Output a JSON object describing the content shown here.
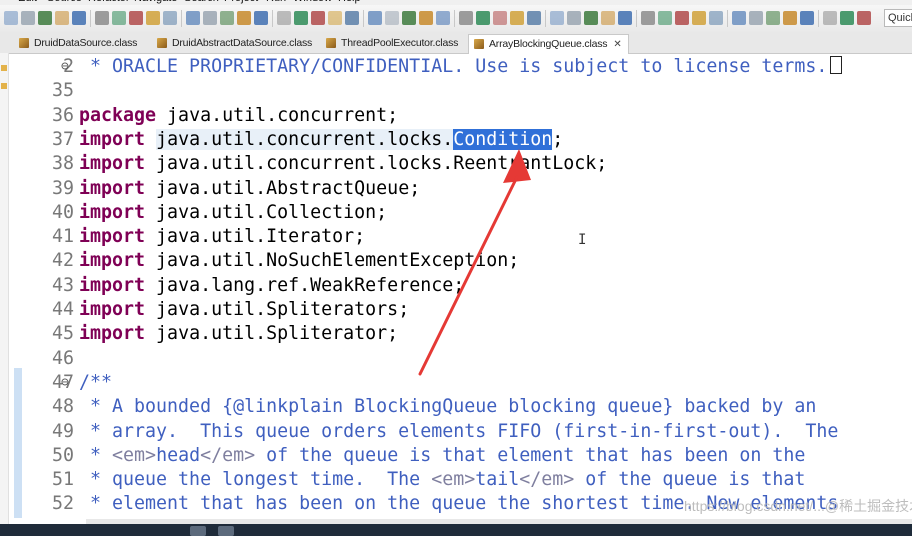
{
  "menu": {
    "items": [
      "Edit",
      "Source",
      "Refactor",
      "Navigate",
      "Search",
      "Project",
      "Run",
      "Window",
      "Help"
    ]
  },
  "toolbar": {
    "quick_access_label": "Quick"
  },
  "tabs": [
    {
      "label": "DruidDataSource.class",
      "active": false
    },
    {
      "label": "DruidAbstractDataSource.class",
      "active": false
    },
    {
      "label": "ThreadPoolExecutor.class",
      "active": false
    },
    {
      "label": "ArrayBlockingQueue.class",
      "active": true
    }
  ],
  "tab_close_glyph": "✕",
  "code_lines": [
    {
      "num": "2",
      "fold": "⊖",
      "segments": [
        {
          "t": " * ORACLE PROPRIETARY/CONFIDENTIAL. Use is subject to license terms.",
          "c": "cm"
        }
      ],
      "caret_box": true
    },
    {
      "num": "35",
      "segments": []
    },
    {
      "num": "36",
      "segments": [
        {
          "t": "package",
          "c": "kw"
        },
        {
          "t": " java.util.concurrent;",
          "c": ""
        }
      ]
    },
    {
      "num": "37",
      "segments": [
        {
          "t": "import",
          "c": "kw"
        },
        {
          "t": " ",
          "c": ""
        },
        {
          "t": "java.util.concurrent.locks.",
          "c": "hlbg"
        },
        {
          "t": "Condition",
          "c": "sel"
        },
        {
          "t": ";",
          "c": ""
        }
      ]
    },
    {
      "num": "38",
      "segments": [
        {
          "t": "import",
          "c": "kw"
        },
        {
          "t": " java.util.concurrent.locks.ReentrantLock;",
          "c": ""
        }
      ]
    },
    {
      "num": "39",
      "segments": [
        {
          "t": "import",
          "c": "kw"
        },
        {
          "t": " java.util.AbstractQueue;",
          "c": ""
        }
      ]
    },
    {
      "num": "40",
      "segments": [
        {
          "t": "import",
          "c": "kw"
        },
        {
          "t": " java.util.Collection;",
          "c": ""
        }
      ]
    },
    {
      "num": "41",
      "segments": [
        {
          "t": "import",
          "c": "kw"
        },
        {
          "t": " java.util.Iterator;",
          "c": ""
        }
      ]
    },
    {
      "num": "42",
      "segments": [
        {
          "t": "import",
          "c": "kw"
        },
        {
          "t": " java.util.NoSuchElementException;",
          "c": ""
        }
      ]
    },
    {
      "num": "43",
      "segments": [
        {
          "t": "import",
          "c": "kw"
        },
        {
          "t": " java.lang.ref.WeakReference;",
          "c": ""
        }
      ]
    },
    {
      "num": "44",
      "segments": [
        {
          "t": "import",
          "c": "kw"
        },
        {
          "t": " java.util.Spliterators;",
          "c": ""
        }
      ]
    },
    {
      "num": "45",
      "segments": [
        {
          "t": "import",
          "c": "kw"
        },
        {
          "t": " java.util.Spliterator;",
          "c": ""
        }
      ]
    },
    {
      "num": "46",
      "segments": []
    },
    {
      "num": "47",
      "fold": "⊖",
      "segments": [
        {
          "t": "/**",
          "c": "cm"
        }
      ]
    },
    {
      "num": "48",
      "segments": [
        {
          "t": " * A bounded {@linkplain BlockingQueue blocking queue} backed by an",
          "c": "cm"
        }
      ]
    },
    {
      "num": "49",
      "segments": [
        {
          "t": " * array.  This queue orders elements FIFO (first-in-first-out).  The",
          "c": "cm"
        }
      ]
    },
    {
      "num": "50",
      "segments": [
        {
          "t": " * ",
          "c": "cm"
        },
        {
          "t": "<em>",
          "c": "tag"
        },
        {
          "t": "head",
          "c": "cm"
        },
        {
          "t": "</em>",
          "c": "tag"
        },
        {
          "t": " of the queue is that element that has been on the",
          "c": "cm"
        }
      ]
    },
    {
      "num": "51",
      "segments": [
        {
          "t": " * queue the longest time.  The ",
          "c": "cm"
        },
        {
          "t": "<em>",
          "c": "tag"
        },
        {
          "t": "tail",
          "c": "cm"
        },
        {
          "t": "</em>",
          "c": "tag"
        },
        {
          "t": " of the queue is that",
          "c": "cm"
        }
      ]
    },
    {
      "num": "52",
      "segments": [
        {
          "t": " * element that has been on the queue the shortest time. New elements",
          "c": "cm"
        }
      ]
    }
  ],
  "cursor_glyph": "I",
  "watermark": "https://blog.csdn.net/...@稀土掘金技术社区",
  "colors": {
    "keyword": "#7f0055",
    "comment": "#3f5fbf",
    "selection": "#3070d8",
    "annotation_arrow": "#e53935"
  }
}
